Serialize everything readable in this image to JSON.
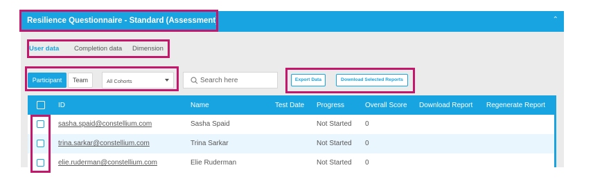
{
  "header": {
    "title": "Resilience Questionnaire - Standard (Assessment)",
    "collapse_icon": "chevron-up-icon"
  },
  "tabs": [
    {
      "label": "User data",
      "active": true
    },
    {
      "label": "Completion data",
      "active": false
    },
    {
      "label": "Dimension",
      "active": false
    }
  ],
  "toggle": {
    "participant": "Participant",
    "team": "Team"
  },
  "cohort_select": {
    "value": "All Cohorts"
  },
  "search": {
    "placeholder": "Search here",
    "value": ""
  },
  "buttons": {
    "export": "Export Data",
    "download_selected": "Download Selected Reports"
  },
  "table": {
    "columns": [
      "ID",
      "Name",
      "Test Date",
      "Progress",
      "Overall Score",
      "Download Report",
      "Regenerate Report"
    ],
    "rows": [
      {
        "id": "sasha.spaid@constellium.com",
        "name": "Sasha Spaid",
        "test_date": "",
        "progress": "Not Started",
        "score": "0"
      },
      {
        "id": "trina.sarkar@constellium.com",
        "name": "Trina Sarkar",
        "test_date": "",
        "progress": "Not Started",
        "score": "0"
      },
      {
        "id": "elie.ruderman@constellium.com",
        "name": "Elie Ruderman",
        "test_date": "",
        "progress": "Not Started",
        "score": "0"
      }
    ]
  },
  "colors": {
    "accent": "#18a4e0",
    "highlight": "#c4176c",
    "panel_bg": "#ebebeb",
    "alt_row": "#eaf6fd"
  }
}
